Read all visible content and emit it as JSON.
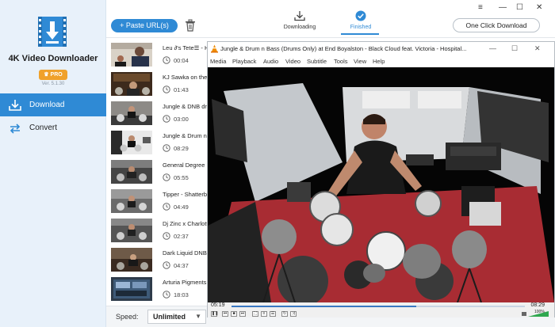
{
  "app": {
    "title": "4K Video Downloader",
    "pro_badge": "PRO",
    "version": "Ver. 5.1.30"
  },
  "nav": [
    {
      "label": "Download",
      "icon": "download-icon",
      "active": true
    },
    {
      "label": "Convert",
      "icon": "convert-icon",
      "active": false
    }
  ],
  "toolbar": {
    "paste_label": "+ Paste URL(s)",
    "trash_icon": "trash-icon",
    "downloading_label": "Downloading",
    "finished_label": "Finished",
    "one_click_label": "One Click Download",
    "window_controls": [
      "≡",
      "—",
      "☐",
      "✕"
    ]
  },
  "videos": [
    {
      "title": "Leu ∂'s Tete☰ - H",
      "duration": "00:04"
    },
    {
      "title": "KJ Sawka on the J",
      "duration": "01:43"
    },
    {
      "title": "Jungle & DNB dru",
      "duration": "03:00"
    },
    {
      "title": "Jungle & Drum n",
      "duration": "08:29"
    },
    {
      "title": "General Degree R",
      "duration": "05:55"
    },
    {
      "title": "Tipper - Shatterba",
      "duration": "04:49"
    },
    {
      "title": "Dj Zinc x Charlott",
      "duration": "02:37"
    },
    {
      "title": "Dark Liquid DNB",
      "duration": "04:37"
    },
    {
      "title": "Arturia Pigments",
      "duration": "18:03"
    }
  ],
  "bottom": {
    "speed_label": "Speed:",
    "speed_value": "Unlimited"
  },
  "vlc": {
    "title": "Jungle & Drum n Bass (Drums Only) at End Boyalston - Black Cloud feat. Victoria - Hospital...",
    "window_controls": [
      "—",
      "☐",
      "✕"
    ],
    "menu": [
      "Media",
      "Playback",
      "Audio",
      "Video",
      "Subtitle",
      "Tools",
      "View",
      "Help"
    ],
    "time_elapsed": "05:19",
    "time_total": "08:29",
    "progress": 0.63,
    "volume_percent": "100%",
    "volume": 1.0
  },
  "colors": {
    "accent": "#2f8ad5",
    "sidebar_bg": "#e8f1fa",
    "pro_badge": "#f0a12a"
  }
}
